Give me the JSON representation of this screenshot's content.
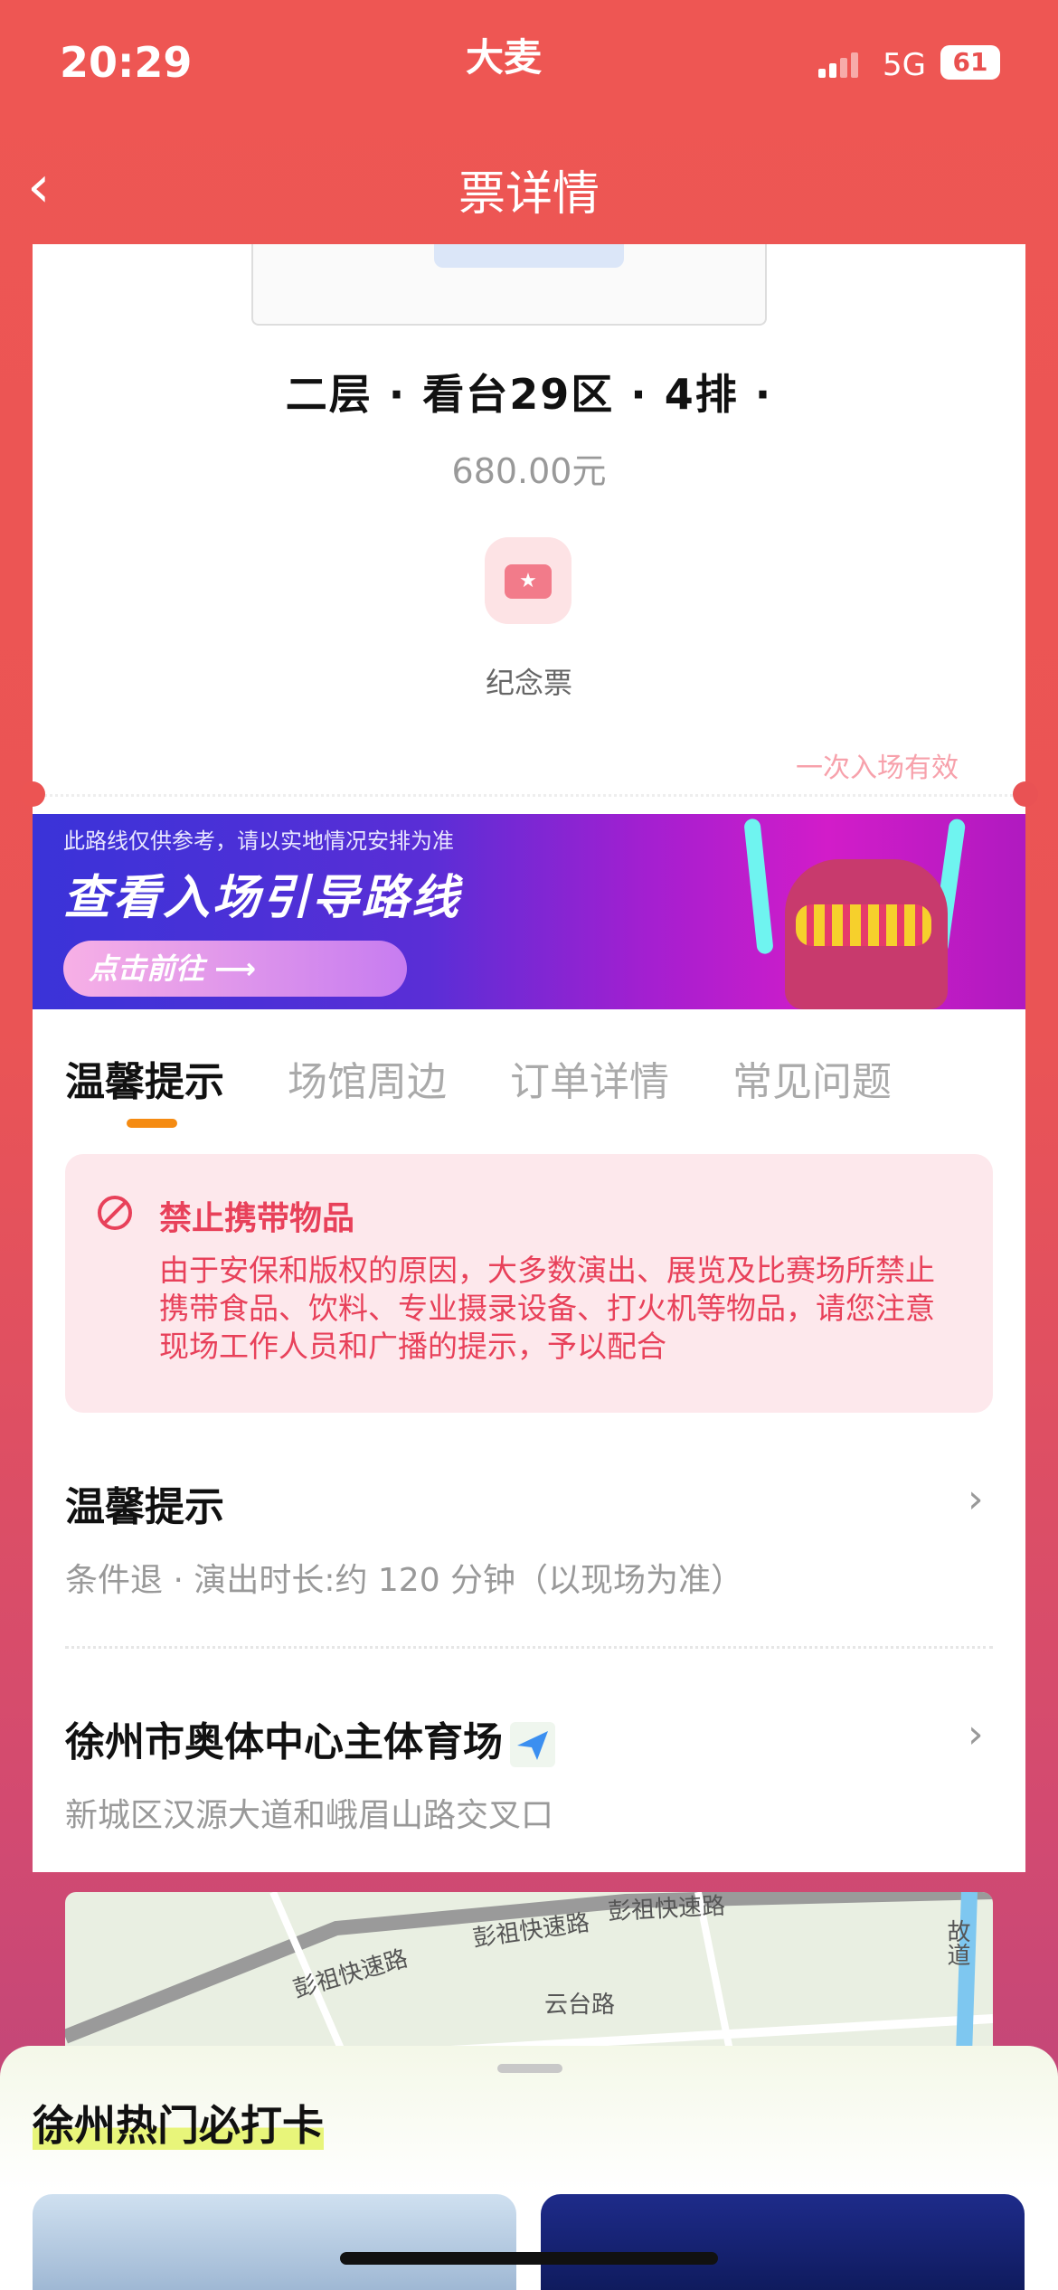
{
  "status_bar": {
    "time": "20:29",
    "network": "5G",
    "battery": "61",
    "brand": "大麦"
  },
  "nav": {
    "title": "票详情"
  },
  "ticket": {
    "seat": "二层 · 看台29区 · 4排 · ",
    "price": "680.00元",
    "type_label": "纪念票",
    "validity": "一次入场有效"
  },
  "banner": {
    "note": "此路线仅供参考，请以实地情况安排为准",
    "headline": "查看入场引导路线",
    "button": "点击前往 ⟶"
  },
  "tabs": [
    {
      "label": "温馨提示"
    },
    {
      "label": "场馆周边"
    },
    {
      "label": "订单详情"
    },
    {
      "label": "常见问题"
    }
  ],
  "warning": {
    "title": "禁止携带物品",
    "text": "由于安保和版权的原因，大多数演出、展览及比赛场所禁止携带食品、饮料、专业摄录设备、打火机等物品，请您注意现场工作人员和广播的提示，予以配合"
  },
  "tips": {
    "title": "温馨提示",
    "subtitle": "条件退 · 演出时长:约 120 分钟（以现场为准）"
  },
  "venue": {
    "name": "徐州市奥体中心主体育场",
    "address": "新城区汉源大道和峨眉山路交叉口"
  },
  "map": {
    "labels": [
      "彭祖快速路",
      "彭祖快速路",
      "彭祖快速路",
      "云台路",
      "速路",
      "故道"
    ]
  },
  "bottom_sheet": {
    "title": "徐州热门必打卡"
  },
  "colors": {
    "primary": "#ea5455",
    "accent_orange": "#f58b12",
    "warn": "#e8415a"
  }
}
